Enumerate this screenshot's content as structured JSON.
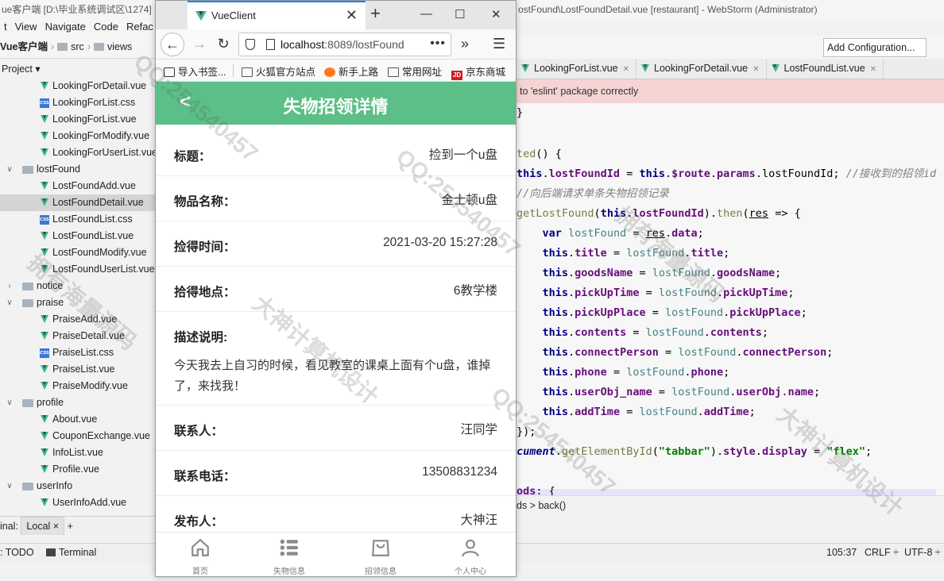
{
  "ide": {
    "title_left": "ue客户端 [D:\\毕业系统调试区\\1274]",
    "title_right": "ostFound\\LostFoundDetail.vue [restaurant] - WebStorm (Administrator)",
    "menu": [
      "t",
      "View",
      "Navigate",
      "Code",
      "Refac"
    ],
    "nav_path": [
      "Vue客户端",
      "src",
      "views"
    ],
    "project_label": "Project",
    "tree": [
      {
        "label": "LookingForDetail.vue",
        "type": "vue",
        "depth": 2
      },
      {
        "label": "LookingForList.css",
        "type": "css",
        "depth": 2
      },
      {
        "label": "LookingForList.vue",
        "type": "vue",
        "depth": 2
      },
      {
        "label": "LookingForModify.vue",
        "type": "vue",
        "depth": 2
      },
      {
        "label": "LookingForUserList.vue",
        "type": "vue",
        "depth": 2
      },
      {
        "label": "lostFound",
        "type": "folder",
        "depth": 1,
        "state": "open"
      },
      {
        "label": "LostFoundAdd.vue",
        "type": "vue",
        "depth": 2
      },
      {
        "label": "LostFoundDetail.vue",
        "type": "vue",
        "depth": 2,
        "selected": true
      },
      {
        "label": "LostFoundList.css",
        "type": "css",
        "depth": 2
      },
      {
        "label": "LostFoundList.vue",
        "type": "vue",
        "depth": 2
      },
      {
        "label": "LostFoundModify.vue",
        "type": "vue",
        "depth": 2
      },
      {
        "label": "LostFoundUserList.vue",
        "type": "vue",
        "depth": 2
      },
      {
        "label": "notice",
        "type": "folder",
        "depth": 1,
        "state": "closed"
      },
      {
        "label": "praise",
        "type": "folder",
        "depth": 1,
        "state": "open"
      },
      {
        "label": "PraiseAdd.vue",
        "type": "vue",
        "depth": 2
      },
      {
        "label": "PraiseDetail.vue",
        "type": "vue",
        "depth": 2
      },
      {
        "label": "PraiseList.css",
        "type": "css",
        "depth": 2
      },
      {
        "label": "PraiseList.vue",
        "type": "vue",
        "depth": 2
      },
      {
        "label": "PraiseModify.vue",
        "type": "vue",
        "depth": 2
      },
      {
        "label": "profile",
        "type": "folder",
        "depth": 1,
        "state": "open"
      },
      {
        "label": "About.vue",
        "type": "vue",
        "depth": 2
      },
      {
        "label": "CouponExchange.vue",
        "type": "vue",
        "depth": 2
      },
      {
        "label": "InfoList.vue",
        "type": "vue",
        "depth": 2
      },
      {
        "label": "Profile.vue",
        "type": "vue",
        "depth": 2
      },
      {
        "label": "userInfo",
        "type": "folder",
        "depth": 1,
        "state": "open"
      },
      {
        "label": "UserInfoAdd.vue",
        "type": "vue",
        "depth": 2
      }
    ],
    "terminal_label": "inal:",
    "terminal_tab": "Local",
    "add_configuration": "Add Configuration...",
    "editor_tabs": [
      "LookingForList.vue",
      "LookingForDetail.vue",
      "LostFoundList.vue"
    ],
    "banner": "to 'eslint' package correctly",
    "breadcrumb": "ds  >  back()",
    "status": {
      "todo": ": TODO",
      "terminal": "Terminal",
      "position": "105:37",
      "line_sep": "CRLF ÷",
      "encoding": "UTF-8 ÷"
    }
  },
  "browser": {
    "tab_title": "VueClient",
    "url_host": "localhost",
    "url_rest": ":8089/lostFound",
    "bookmarks": [
      "导入书签...",
      "火狐官方站点",
      "新手上路",
      "常用网址",
      "京东商城"
    ]
  },
  "app": {
    "header_title": "失物招领详情",
    "fields": [
      {
        "label": "标题：",
        "value": "捡到一个u盘"
      },
      {
        "label": "物品名称：",
        "value": "金士顿u盘"
      },
      {
        "label": "捡得时间：",
        "value": "2021-03-20 15:27:28"
      },
      {
        "label": "拾得地点：",
        "value": "6教学楼"
      }
    ],
    "description_label": "描述说明:",
    "description_text": "今天我去上自习的时候，看见教室的课桌上面有个u盘，谁掉了，来找我！",
    "contact_fields": [
      {
        "label": "联系人：",
        "value": "汪同学"
      },
      {
        "label": "联系电话：",
        "value": "13508831234"
      },
      {
        "label": "发布人：",
        "value": "大神汪"
      }
    ],
    "tabbar": [
      {
        "label": "首页",
        "icon": "home-icon"
      },
      {
        "label": "失物信息",
        "icon": "list-icon"
      },
      {
        "label": "招领信息",
        "icon": "bag-icon"
      },
      {
        "label": "个人中心",
        "icon": "user-icon"
      }
    ],
    "accent": "#5bbf87"
  },
  "watermarks": [
    "QQ:254540457",
    "拥有海量源码",
    "大神计算机设计"
  ]
}
